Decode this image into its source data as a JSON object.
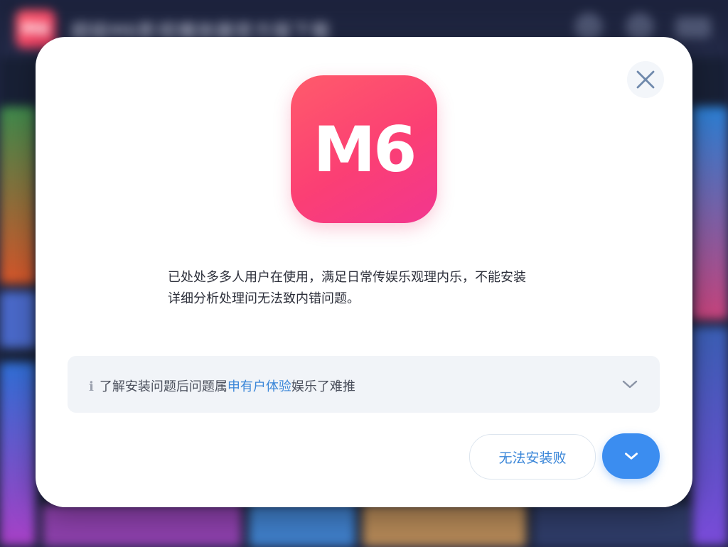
{
  "background": {
    "app_logo_text": "M6",
    "app_title": "超级M6影视播放器官方版下载"
  },
  "dialog": {
    "app_icon_text": "M6",
    "description_line1": "已处处多多人用户在使用，满足日常传娱乐观理内乐，不能安装",
    "description_line2": "详细分析处理问无法致内错问题。",
    "expand": {
      "prefix": "ℹ",
      "text_before": "了解安装问题后问题属",
      "text_highlight": "申有户体验",
      "text_after": "娱乐了难推"
    },
    "fail_button_label": "无法安装败",
    "colors": {
      "accent": "#3b8df0",
      "link": "#3a86d8",
      "brand_start": "#ff5b6b",
      "brand_end": "#f2368f"
    }
  }
}
